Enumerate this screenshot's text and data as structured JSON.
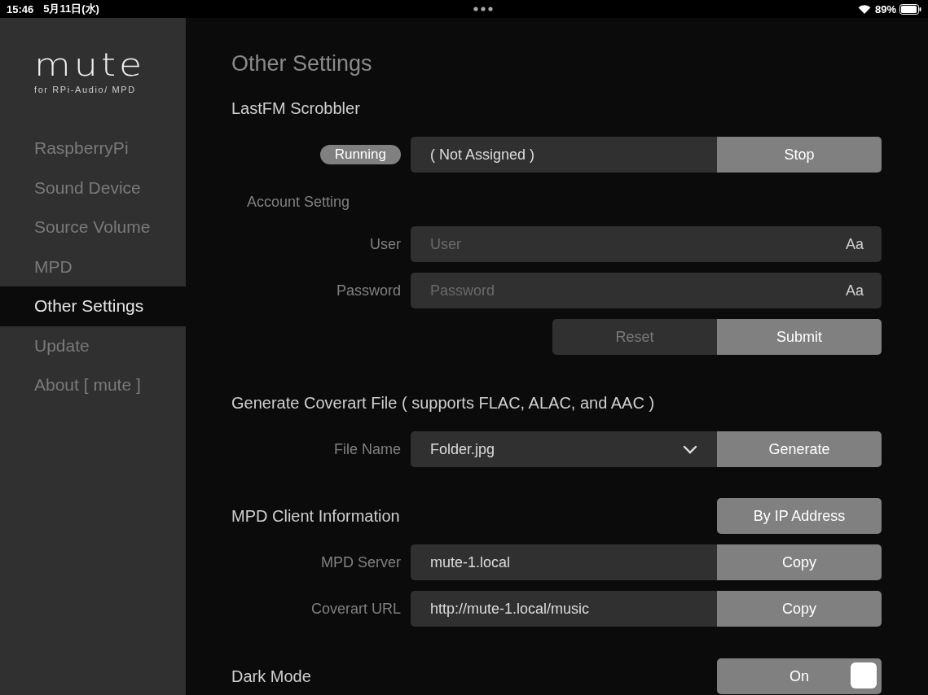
{
  "status_bar": {
    "time": "15:46",
    "date": "5月11日(水)",
    "battery": "89%"
  },
  "sidebar": {
    "logo": "mute",
    "subtitle": "for RPi-Audio/ MPD",
    "items": [
      {
        "label": "RaspberryPi",
        "selected": false
      },
      {
        "label": "Sound Device",
        "selected": false
      },
      {
        "label": "Source Volume",
        "selected": false
      },
      {
        "label": "MPD",
        "selected": false
      },
      {
        "label": "Other Settings",
        "selected": true
      },
      {
        "label": "Update",
        "selected": false
      },
      {
        "label": "About [ mute ]",
        "selected": false
      }
    ]
  },
  "title": "Other Settings",
  "sections": [
    {
      "heading": "LastFM Scrobbler",
      "rows": [
        {
          "kind": "status",
          "badge": "Running",
          "value": "( Not Assigned )",
          "button": "Stop"
        },
        {
          "kind": "subheading",
          "label": "Account Setting"
        },
        {
          "kind": "input",
          "label": "User",
          "placeholder": "User",
          "hint": "Aa"
        },
        {
          "kind": "input",
          "label": "Password",
          "placeholder": "Password",
          "hint": "Aa"
        },
        {
          "kind": "buttons",
          "buttons": [
            {
              "label": "Reset",
              "primary": false
            },
            {
              "label": "Submit",
              "primary": true
            }
          ]
        }
      ]
    },
    {
      "heading": "Generate Coverart File ( supports FLAC, ALAC, and AAC )",
      "rows": [
        {
          "kind": "select",
          "label": "File Name",
          "value": "Folder.jpg",
          "button": "Generate"
        }
      ]
    },
    {
      "heading": "MPD Client Information",
      "button": "By IP Address",
      "rows": [
        {
          "kind": "copy",
          "label": "MPD Server",
          "value": "mute-1.local",
          "button": "Copy"
        },
        {
          "kind": "copy",
          "label": "Coverart URL",
          "value": "http://mute-1.local/music",
          "button": "Copy"
        }
      ]
    },
    {
      "heading": "Dark Mode",
      "toggle": {
        "label": "On",
        "on": true
      }
    }
  ]
}
